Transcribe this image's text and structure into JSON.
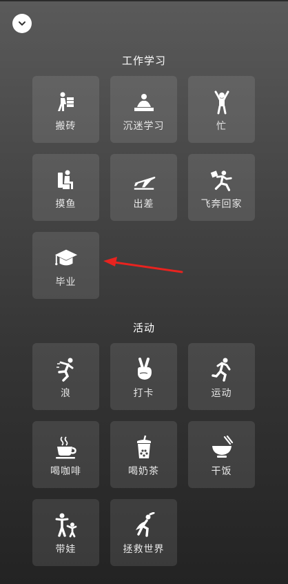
{
  "sections": [
    {
      "title": "工作学习",
      "items": [
        {
          "label": "搬砖",
          "icon": "carry-bricks-icon"
        },
        {
          "label": "沉迷学习",
          "icon": "studying-icon"
        },
        {
          "label": "忙",
          "icon": "busy-icon"
        },
        {
          "label": "摸鱼",
          "icon": "slacking-icon"
        },
        {
          "label": "出差",
          "icon": "airplane-icon"
        },
        {
          "label": "飞奔回家",
          "icon": "running-home-icon"
        },
        {
          "label": "毕业",
          "icon": "graduation-cap-icon"
        }
      ]
    },
    {
      "title": "活动",
      "items": [
        {
          "label": "浪",
          "icon": "jumping-person-icon"
        },
        {
          "label": "打卡",
          "icon": "victory-hand-icon"
        },
        {
          "label": "运动",
          "icon": "running-person-icon"
        },
        {
          "label": "喝咖啡",
          "icon": "coffee-cup-icon"
        },
        {
          "label": "喝奶茶",
          "icon": "bubble-tea-icon"
        },
        {
          "label": "干饭",
          "icon": "rice-bowl-icon"
        },
        {
          "label": "带娃",
          "icon": "parent-child-icon"
        },
        {
          "label": "拯救世界",
          "icon": "superhero-icon"
        }
      ]
    }
  ],
  "annotation": {
    "type": "red-arrow",
    "target": "毕业",
    "color": "#e8231f"
  }
}
